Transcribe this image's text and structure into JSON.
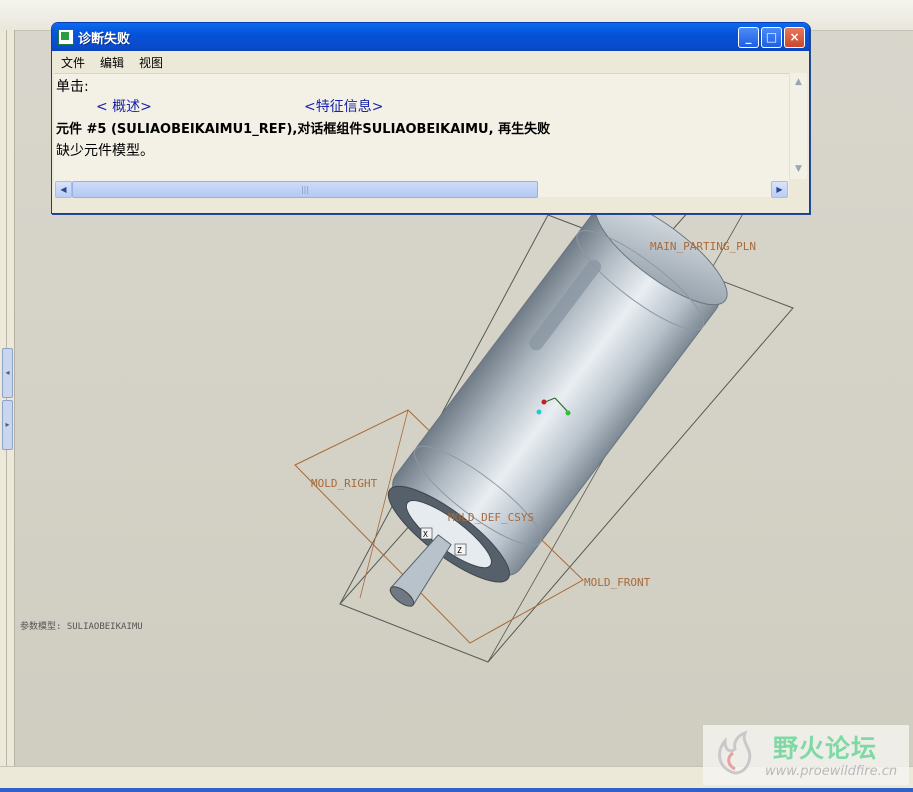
{
  "dialog": {
    "title": "诊断失败",
    "menu": [
      "文件",
      "编辑",
      "视图"
    ],
    "lines": {
      "click": "单击:",
      "link_overview": "< 概述>",
      "link_feature": "<特征信息>",
      "message1": "元件 #5 (SULIAOBEIKAIMU1_REF),对话框组件SULIAOBEIKAIMU,  再生失败",
      "message2": "缺少元件模型。"
    },
    "hscroll_thumb": "|||",
    "buttons": {
      "minimize": "_",
      "maximize": "□",
      "close": "×"
    }
  },
  "viewport": {
    "labels": {
      "main_parting": "MAIN_PARTING_PLN",
      "mold_right": "MOLD_RIGHT",
      "mold_def_csys": "MOLD_DEF_CSYS",
      "mold_front": "MOLD_FRONT",
      "csys_x": "X",
      "csys_z": "Z"
    },
    "model_name": "参数模型: SULIAOBEIKAIMU"
  },
  "watermark": {
    "title": "野火论坛",
    "url": "www.proewildfire.cn"
  },
  "colors": {
    "titlebar": "#0552d8",
    "datum_plane": "#a86a3a",
    "link": "#1a23a7"
  }
}
